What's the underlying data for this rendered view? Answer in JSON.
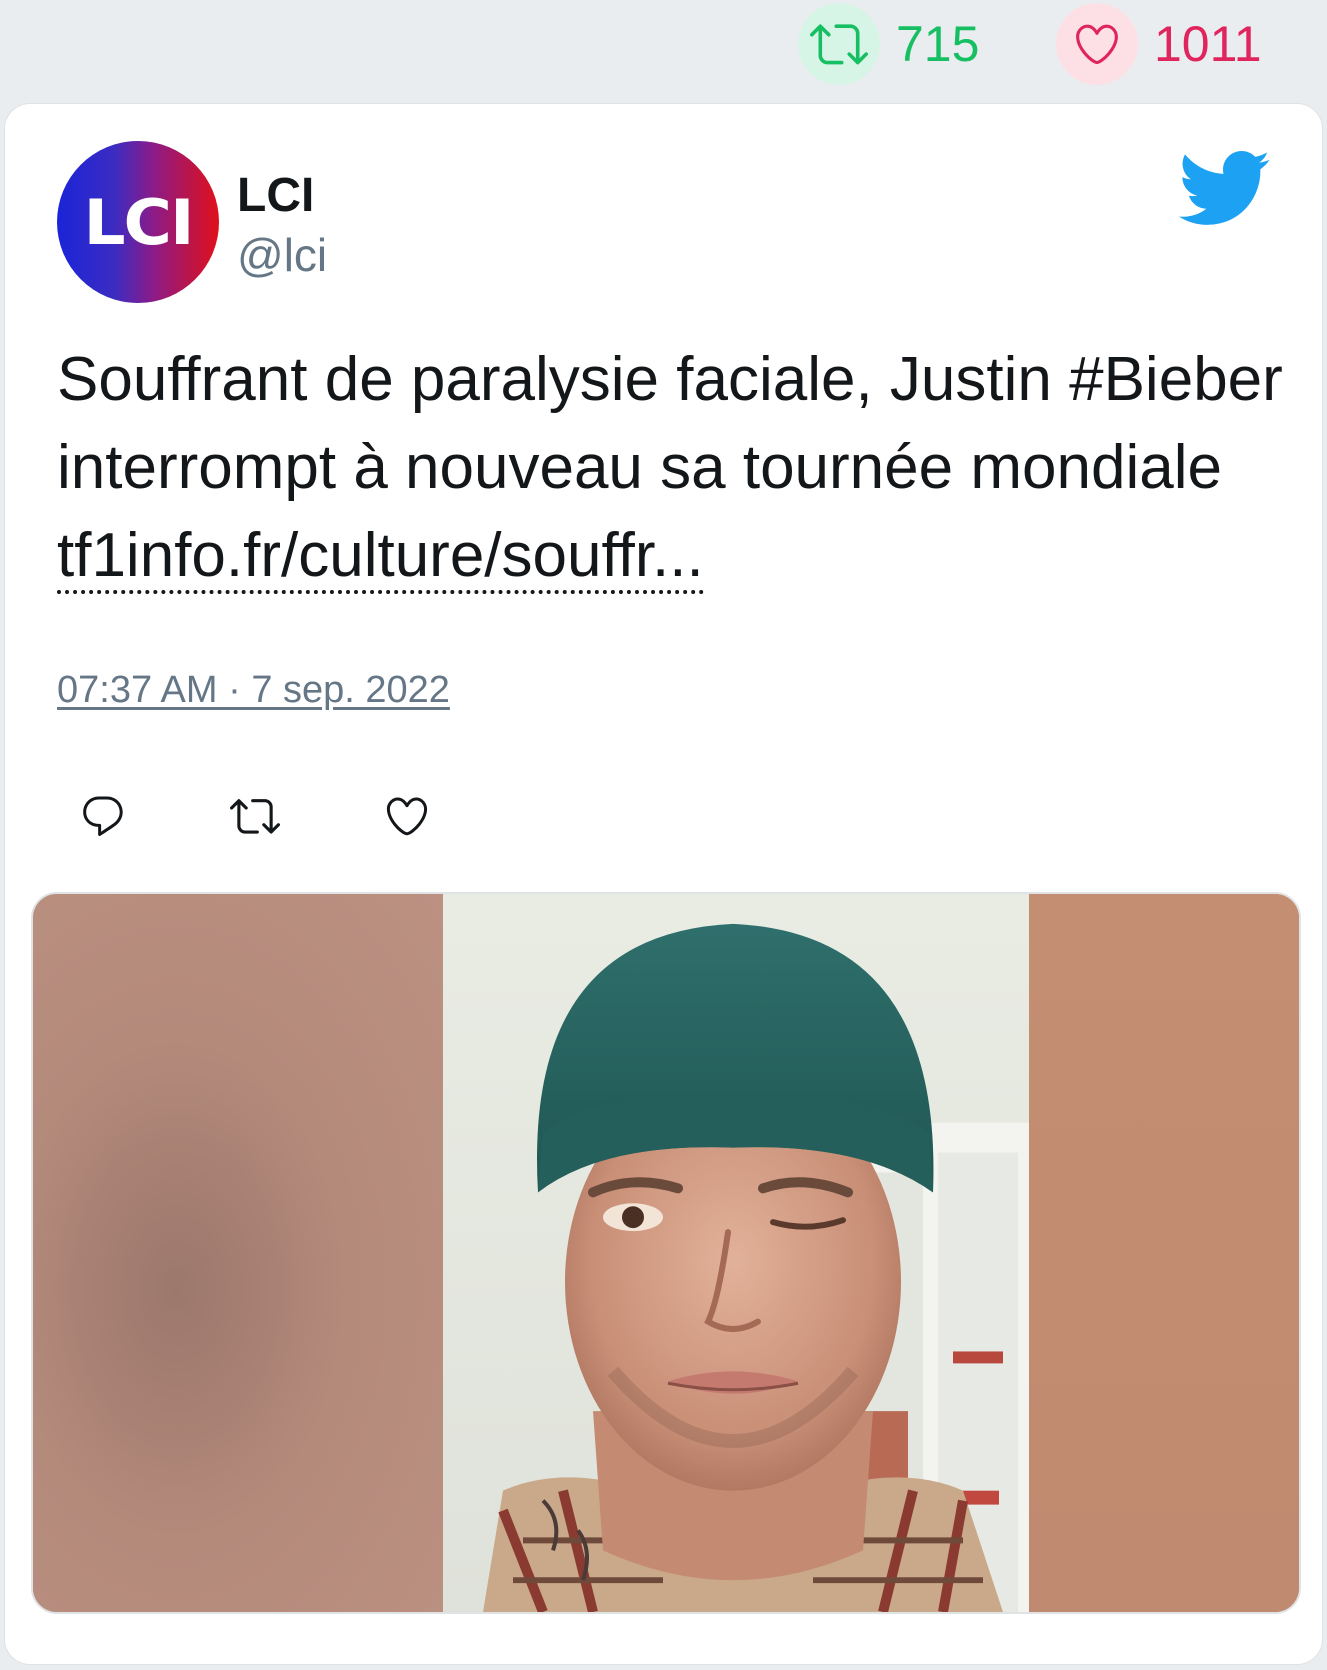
{
  "stats": {
    "retweet_count": "715",
    "like_count": "1011",
    "retweet_icon": "retweet-icon",
    "like_icon": "heart-icon",
    "retweet_color": "#17bf63",
    "like_color": "#e0245e"
  },
  "tweet": {
    "author": {
      "name": "LCI",
      "handle": "@lci",
      "avatar_text": "LCI"
    },
    "platform_icon": "twitter-bird-icon",
    "text_main": "Souffrant de paralysie faciale, Justin #Bieber interrompt à nouveau sa tournée mondiale ",
    "link_text": "tf1info.fr/culture/souffr...",
    "timestamp": "07:37 AM · 7 sep. 2022",
    "actions": [
      "reply-icon",
      "retweet-icon",
      "like-icon"
    ],
    "media": {
      "type": "image"
    }
  },
  "colors": {
    "background": "#eaedf0",
    "card": "#ffffff",
    "text": "#14171a",
    "muted": "#657786",
    "twitter_blue": "#1da1f2"
  }
}
